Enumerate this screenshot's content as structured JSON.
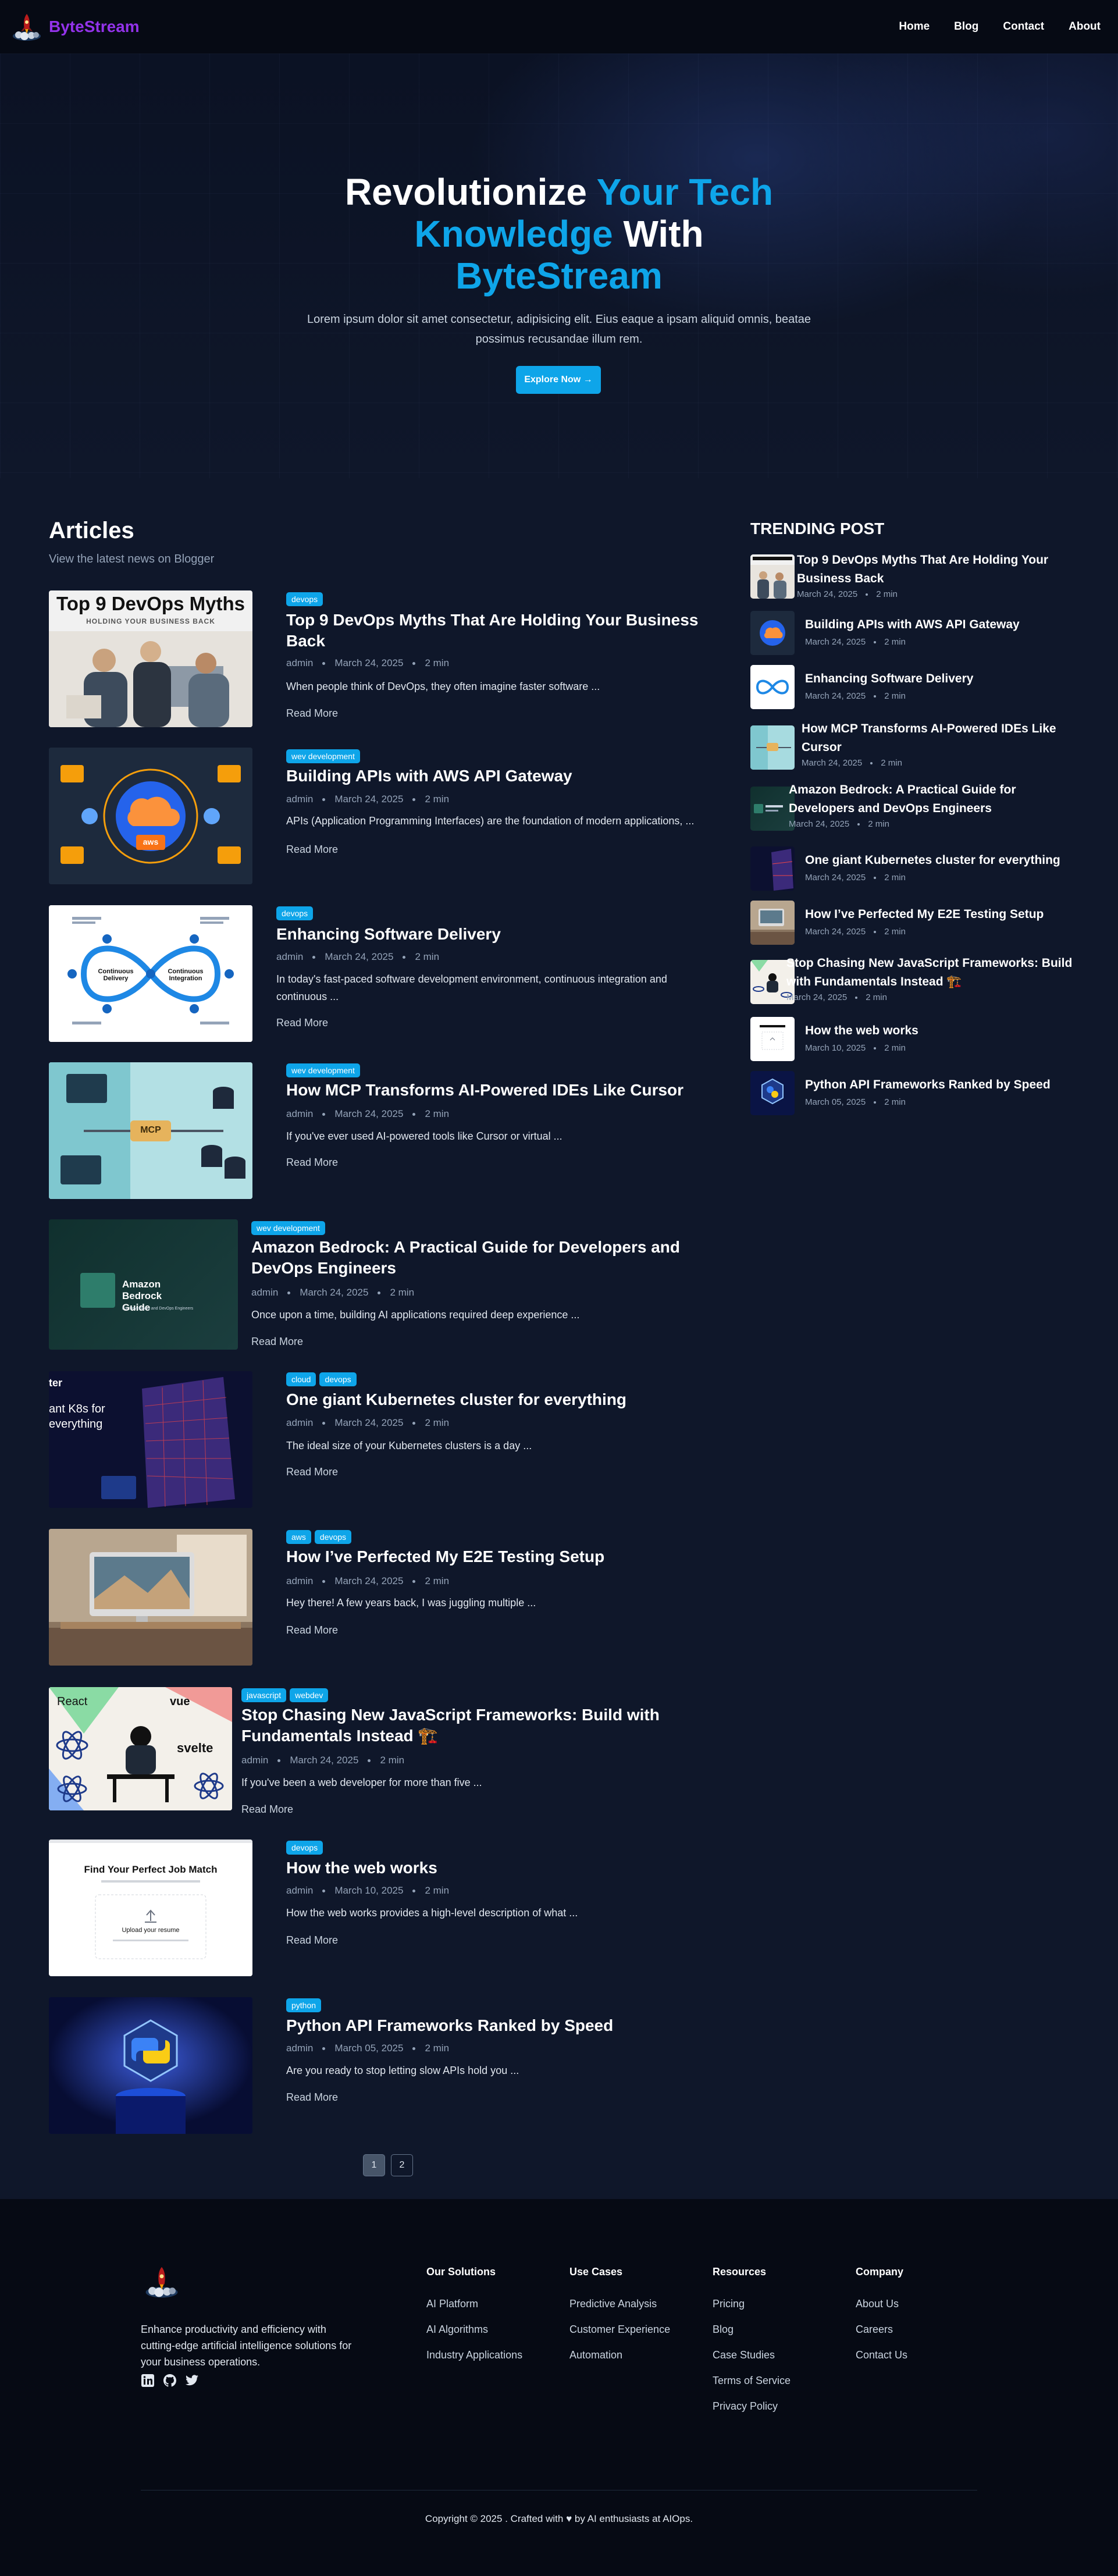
{
  "brand": {
    "name": "ByteStream"
  },
  "nav": {
    "items": [
      "Home",
      "Blog",
      "Contact",
      "About"
    ]
  },
  "hero": {
    "title_part1": "Revolutionize ",
    "title_hl1": "Your Tech Knowledge",
    "title_part2": " With ",
    "title_hl2": "ByteStream",
    "description": "Lorem ipsum dolor sit amet consectetur, adipisicing elit. Eius eaque a ipsam aliquid omnis, beatae possimus recusandae illum rem.",
    "button": "Explore Now →"
  },
  "articles": {
    "title": "Articles",
    "subtitle": "View the latest news on Blogger",
    "read_more": "Read More",
    "posts": [
      {
        "tags": [
          "devops"
        ],
        "title": "Top 9 DevOps Myths That Are Holding Your Business Back",
        "author": "admin",
        "date": "March 24, 2025",
        "read": "2 min",
        "excerpt": "When people think of DevOps, they often imagine faster software ...",
        "thumb_text": "Top 9 DevOps Myths",
        "thumb_sub": "HOLDING YOUR BUSINESS BACK"
      },
      {
        "tags": [
          "wev development"
        ],
        "title": "Building APIs with AWS API Gateway",
        "author": "admin",
        "date": "March 24, 2025",
        "read": "2 min",
        "excerpt": "APIs (Application Programming Interfaces) are the foundation of modern applications, ...",
        "thumb_text": "aws"
      },
      {
        "tags": [
          "devops"
        ],
        "title": "Enhancing Software Delivery",
        "author": "admin",
        "date": "March 24, 2025",
        "read": "2 min",
        "excerpt": "In today's fast-paced software development environment, continuous integration and continuous ...",
        "thumb_left": "Continuous Delivery",
        "thumb_right": "Continuous Integration"
      },
      {
        "tags": [
          "wev development"
        ],
        "title": "How MCP Transforms AI-Powered IDEs Like Cursor",
        "author": "admin",
        "date": "March 24, 2025",
        "read": "2 min",
        "excerpt": "If you've ever used AI-powered tools like Cursor or virtual ...",
        "thumb_text": "MCP"
      },
      {
        "tags": [
          "wev development"
        ],
        "title": "Amazon Bedrock: A Practical Guide for Developers and DevOps Engineers",
        "author": "admin",
        "date": "March 24, 2025",
        "read": "2 min",
        "excerpt": "Once upon a time, building AI applications required deep experience ...",
        "thumb_text": "Amazon Bedrock Guide",
        "thumb_sub": "For Developers and DevOps Engineers"
      },
      {
        "tags": [
          "cloud",
          "devops"
        ],
        "title": "One giant Kubernetes cluster for everything",
        "author": "admin",
        "date": "March 24, 2025",
        "read": "2 min",
        "excerpt": "The ideal size of your Kubernetes clusters is a day ...",
        "thumb_text": "ter",
        "thumb_sub": "ant K8s for everything"
      },
      {
        "tags": [
          "aws",
          "devops"
        ],
        "title": "How I’ve Perfected My E2E Testing Setup",
        "author": "admin",
        "date": "March 24, 2025",
        "read": "2 min",
        "excerpt": "Hey there! A few years back, I was juggling multiple ..."
      },
      {
        "tags": [
          "javascript",
          "webdev"
        ],
        "title": "Stop Chasing New JavaScript Frameworks: Build with Fundamentals Instead 🏗️",
        "author": "admin",
        "date": "March 24, 2025",
        "read": "2 min",
        "excerpt": "If you've been a web developer for more than five ...",
        "thumb_labels": [
          "React",
          "vue",
          "svelte"
        ]
      },
      {
        "tags": [
          "devops"
        ],
        "title": "How the web works",
        "author": "admin",
        "date": "March 10, 2025",
        "read": "2 min",
        "excerpt": "How the web works provides a high-level description of what ...",
        "thumb_text": "Find Your Perfect Job Match",
        "thumb_sub": "Upload your resume"
      },
      {
        "tags": [
          "python"
        ],
        "title": "Python API Frameworks Ranked by Speed",
        "author": "admin",
        "date": "March 05, 2025",
        "read": "2 min",
        "excerpt": "Are you ready to stop letting slow APIs hold you ..."
      }
    ]
  },
  "trending": {
    "title": "TRENDING POST",
    "items": [
      {
        "title": "Top 9 DevOps Myths That Are Holding Your Business Back",
        "date": "March 24, 2025",
        "read": "2 min"
      },
      {
        "title": "Building APIs with AWS API Gateway",
        "date": "March 24, 2025",
        "read": "2 min"
      },
      {
        "title": "Enhancing Software Delivery",
        "date": "March 24, 2025",
        "read": "2 min"
      },
      {
        "title": "How MCP Transforms AI-Powered IDEs Like Cursor",
        "date": "March 24, 2025",
        "read": "2 min"
      },
      {
        "title": "Amazon Bedrock: A Practical Guide for Developers and DevOps Engineers",
        "date": "March 24, 2025",
        "read": "2 min"
      },
      {
        "title": "One giant Kubernetes cluster for everything",
        "date": "March 24, 2025",
        "read": "2 min"
      },
      {
        "title": "How I’ve Perfected My E2E Testing Setup",
        "date": "March 24, 2025",
        "read": "2 min"
      },
      {
        "title": "Stop Chasing New JavaScript Frameworks: Build with Fundamentals Instead 🏗️",
        "date": "March 24, 2025",
        "read": "2 min"
      },
      {
        "title": "How the web works",
        "date": "March 10, 2025",
        "read": "2 min"
      },
      {
        "title": "Python API Frameworks Ranked by Speed",
        "date": "March 05, 2025",
        "read": "2 min"
      }
    ]
  },
  "pagination": {
    "pages": [
      "1",
      "2"
    ],
    "current": "1"
  },
  "footer": {
    "description": "Enhance productivity and efficiency with cutting-edge artificial intelligence solutions for your business operations.",
    "social": [
      "linkedin-icon",
      "github-icon",
      "twitter-icon"
    ],
    "columns": [
      {
        "title": "Our Solutions",
        "links": [
          "AI Platform",
          "AI Algorithms",
          "Industry Applications"
        ]
      },
      {
        "title": "Use Cases",
        "links": [
          "Predictive Analysis",
          "Customer Experience",
          "Automation"
        ]
      },
      {
        "title": "Resources",
        "links": [
          "Pricing",
          "Blog",
          "Case Studies",
          "Terms of Service",
          "Privacy Policy"
        ]
      },
      {
        "title": "Company",
        "links": [
          "About Us",
          "Careers",
          "Contact Us"
        ]
      }
    ],
    "copyright": "Copyright © 2025 . Crafted with ♥ by AI enthusiasts at AIOps."
  }
}
